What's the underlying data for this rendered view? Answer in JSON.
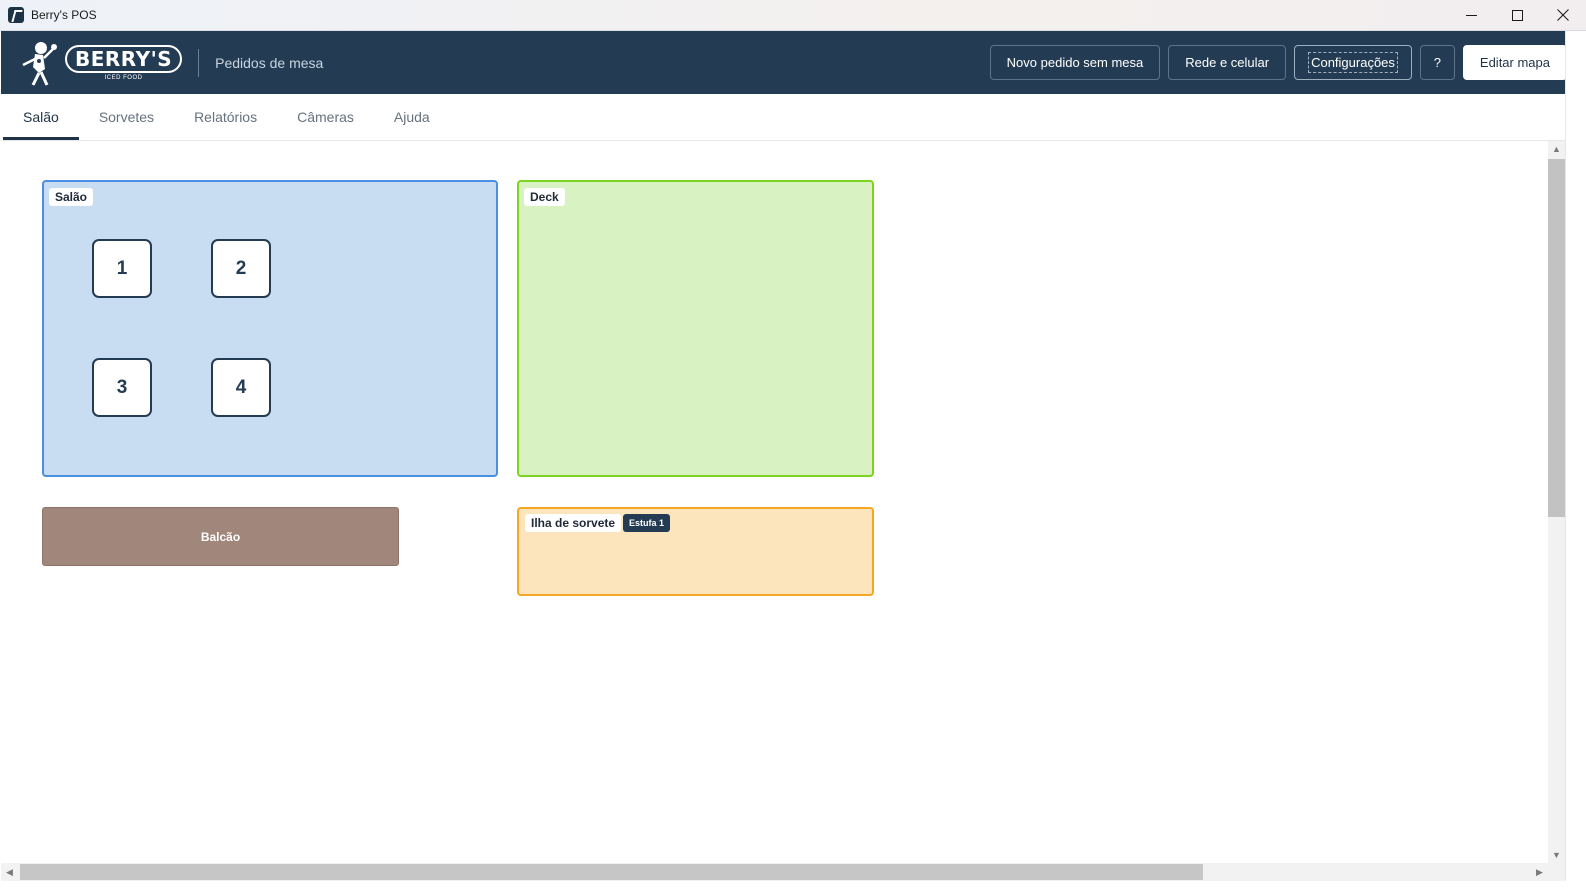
{
  "window": {
    "title": "Berry's POS",
    "controls": [
      "minimize-icon",
      "maximize-icon",
      "close-icon"
    ]
  },
  "header": {
    "logo_text": "BERRY'S",
    "logo_sub": "ICED FOOD",
    "subtitle": "Pedidos de mesa",
    "buttons": {
      "new_order": "Novo pedido sem mesa",
      "network": "Rede e celular",
      "settings": "Configurações",
      "help": "?",
      "edit_map": "Editar mapa"
    }
  },
  "tabs": [
    {
      "label": "Salão",
      "active": true
    },
    {
      "label": "Sorvetes",
      "active": false
    },
    {
      "label": "Relatórios",
      "active": false
    },
    {
      "label": "Câmeras",
      "active": false
    },
    {
      "label": "Ajuda",
      "active": false
    }
  ],
  "map": {
    "zones": {
      "salao": {
        "label": "Salão",
        "color": "#c8dcf2",
        "border": "#4a90e2"
      },
      "deck": {
        "label": "Deck",
        "color": "#d8f3c1",
        "border": "#7ed321"
      },
      "ilha": {
        "label": "Ilha de sorvete",
        "badge": "Estufa 1",
        "color": "#fce4bd",
        "border": "#f5a623"
      }
    },
    "counter": {
      "label": "Balcão",
      "color": "#a0867b"
    },
    "tables": [
      "1",
      "2",
      "3",
      "4"
    ]
  },
  "colors": {
    "header_bg": "#243c53",
    "accent": "#1f3346"
  }
}
